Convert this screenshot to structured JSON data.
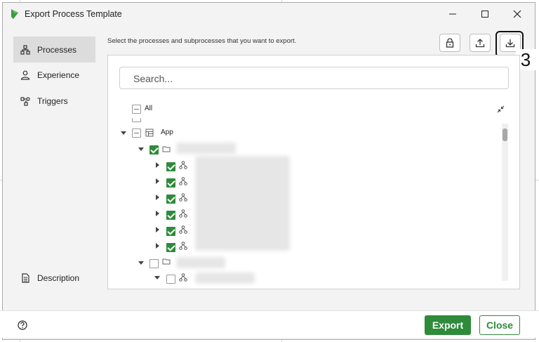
{
  "window": {
    "title": "Export Process Template"
  },
  "sidebar": {
    "items": [
      {
        "label": "Processes",
        "icon": "processes-icon",
        "active": true
      },
      {
        "label": "Experience",
        "icon": "person-icon",
        "active": false
      },
      {
        "label": "Triggers",
        "icon": "triggers-icon",
        "active": false
      }
    ],
    "description_label": "Description"
  },
  "main": {
    "instruction": "Select the processes and subprocesses that you want to export.",
    "search_placeholder": "Search...",
    "tree": {
      "all_label": "All",
      "app_label": "App"
    }
  },
  "annotation": {
    "callout_number": "3"
  },
  "footer": {
    "export_label": "Export",
    "close_label": "Close"
  },
  "colors": {
    "accent": "#2e8b3a"
  }
}
